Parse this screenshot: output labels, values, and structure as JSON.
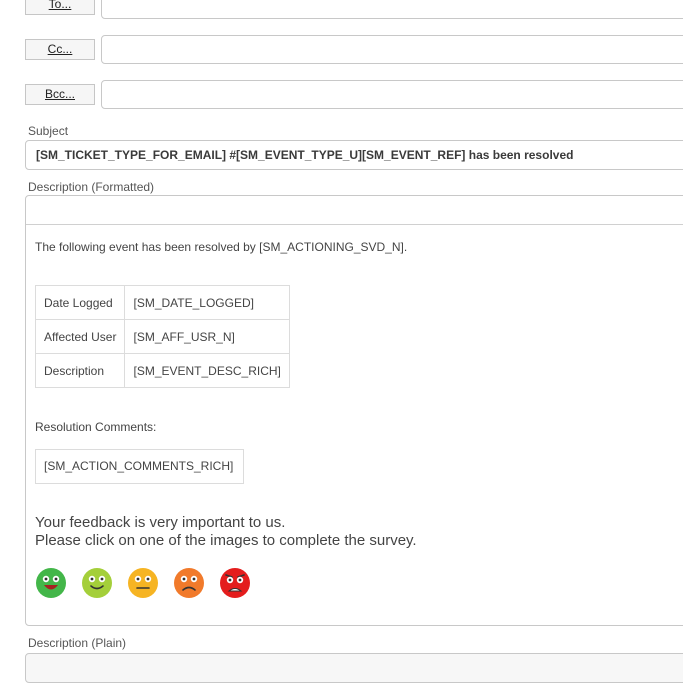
{
  "recipients": {
    "to_label": "To...",
    "cc_label": "Cc...",
    "bcc_label": "Bcc..."
  },
  "subject": {
    "label": "Subject",
    "value": "[SM_TICKET_TYPE_FOR_EMAIL] #[SM_EVENT_TYPE_U][SM_EVENT_REF] has been resolved"
  },
  "description_formatted": {
    "label": "Description (Formatted)",
    "intro": "The following event has been resolved by [SM_ACTIONING_SVD_N].",
    "table": [
      {
        "key": "Date Logged",
        "value": "[SM_DATE_LOGGED]"
      },
      {
        "key": "Affected User",
        "value": "[SM_AFF_USR_N]"
      },
      {
        "key": "Description",
        "value": "[SM_EVENT_DESC_RICH]"
      }
    ],
    "resolution_label": "Resolution Comments:",
    "resolution_value": "[SM_ACTION_COMMENTS_RICH]",
    "feedback_line1": "Your feedback is very important to us.",
    "feedback_line2": "Please click on one of the images to complete the survey.",
    "survey_faces": [
      {
        "icon": "very-happy-face-icon",
        "color": "#43b649"
      },
      {
        "icon": "happy-face-icon",
        "color": "#a4cf3a"
      },
      {
        "icon": "neutral-face-icon",
        "color": "#f6b423"
      },
      {
        "icon": "sad-face-icon",
        "color": "#f17a2b"
      },
      {
        "icon": "angry-face-icon",
        "color": "#e41d1d"
      }
    ]
  },
  "description_plain": {
    "label": "Description (Plain)"
  }
}
